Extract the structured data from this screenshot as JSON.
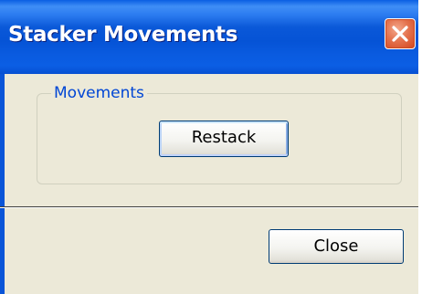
{
  "window": {
    "title": "Stacker Movements"
  },
  "movements_group": {
    "label": "Movements",
    "restack_label": "Restack"
  },
  "footer": {
    "close_label": "Close"
  },
  "colors": {
    "titlebar_blue": "#0A58D8",
    "dialog_face": "#ECE9D8",
    "close_button_red": "#E4724D",
    "group_label_blue": "#0046D5"
  },
  "icons": {
    "close_window": "close-icon"
  }
}
